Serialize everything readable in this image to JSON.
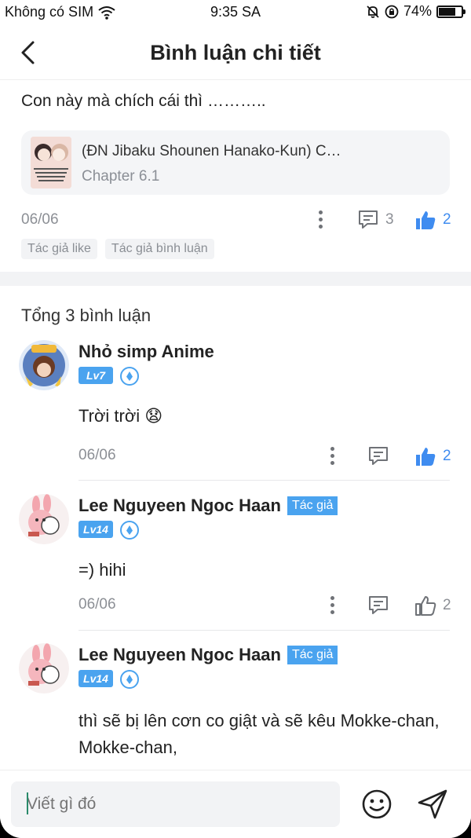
{
  "status_bar": {
    "carrier": "Không có SIM",
    "time": "9:35 SA",
    "battery": "74%",
    "battery_level": 0.74
  },
  "header": {
    "title": "Bình luận chi tiết"
  },
  "main_comment": {
    "text": "Con này mà chích cái thì ………..",
    "story": {
      "title": "(ĐN Jibaku Shounen Hanako-Kun) C…",
      "chapter": "Chapter 6.1"
    },
    "date": "06/06",
    "reply_count": "3",
    "like_count": "2",
    "tags": [
      "Tác giả like",
      "Tác giả bình luận"
    ]
  },
  "comments_section": {
    "total": "Tổng 3 bình luận",
    "comments": [
      {
        "name": "Nhỏ simp Anime",
        "level": "Lv7",
        "author_badge": "",
        "text": "Trời trời 😧",
        "date": "06/06",
        "like_count": "2",
        "liked": true
      },
      {
        "name": "Lee Nguyeen Ngoc Haan",
        "level": "Lv14",
        "author_badge": "Tác giả",
        "text": "=) hihi",
        "date": "06/06",
        "like_count": "2",
        "liked": false
      },
      {
        "name": "Lee Nguyeen Ngoc Haan",
        "level": "Lv14",
        "author_badge": "Tác giả",
        "text": "thì sẽ bị lên cơn co giật và sẽ kêu Mokke-chan, Mokke-chan,",
        "date": "",
        "like_count": "",
        "liked": false
      }
    ]
  },
  "input": {
    "placeholder": "Viết gì đó"
  },
  "colors": {
    "accent": "#3f8cf0",
    "badge": "#4aa3ef",
    "muted": "#8c8f95"
  }
}
